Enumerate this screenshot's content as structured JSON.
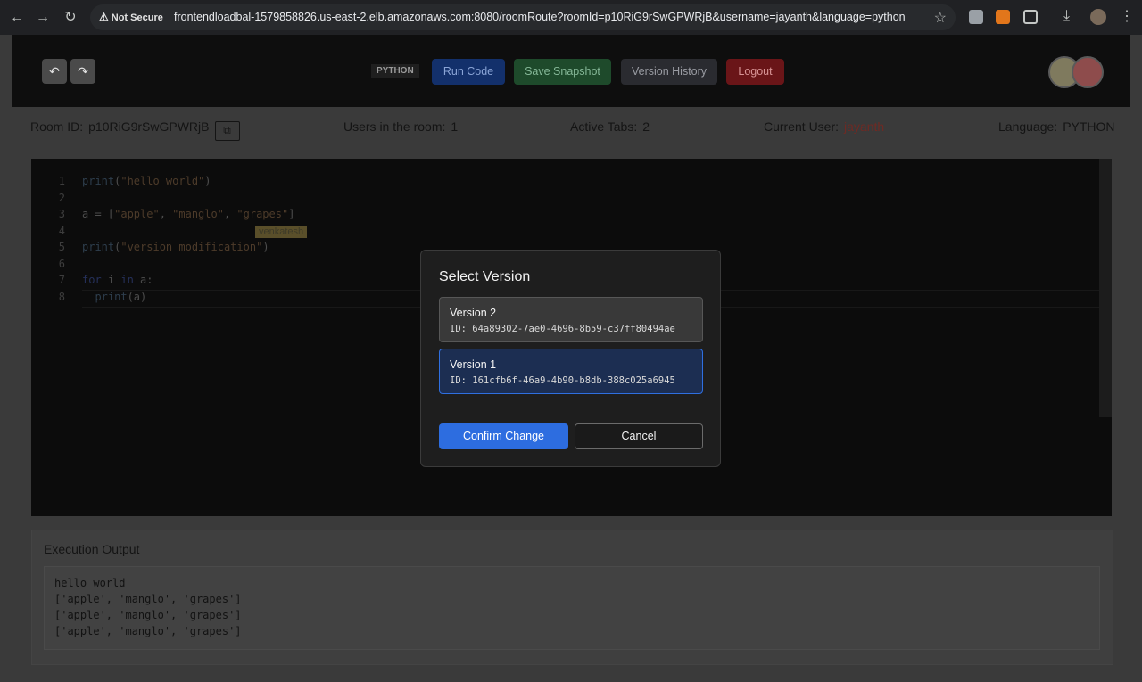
{
  "browser": {
    "security_label": "Not Secure",
    "url": "frontendloadbal-1579858826.us-east-2.elb.amazonaws.com:8080/roomRoute?roomId=p10RiG9rSwGPWRjB&username=jayanth&language=python"
  },
  "toolbar": {
    "undo_icon": "undo-icon",
    "redo_icon": "redo-icon",
    "language_tag": "PYTHON",
    "run_label": "Run Code",
    "snapshot_label": "Save Snapshot",
    "history_label": "Version History",
    "logout_label": "Logout"
  },
  "info": {
    "room_label": "Room ID:",
    "room_id": "p10RiG9rSwGPWRjB",
    "users_label": "Users in the room:",
    "users_count": "1",
    "tabs_label": "Active Tabs:",
    "tabs_count": "2",
    "user_label": "Current User:",
    "user_name": "jayanth",
    "lang_label": "Language:",
    "lang_value": "PYTHON"
  },
  "editor": {
    "line_numbers": [
      "1",
      "2",
      "3",
      "4",
      "5",
      "6",
      "7",
      "8"
    ],
    "cursor_user": "venkatesh"
  },
  "output": {
    "title": "Execution Output",
    "lines": [
      "hello world",
      "['apple', 'manglo', 'grapes']",
      "['apple', 'manglo', 'grapes']",
      "['apple', 'manglo', 'grapes']"
    ]
  },
  "modal": {
    "title": "Select Version",
    "versions": [
      {
        "name": "Version 2",
        "id": "ID: 64a89302-7ae0-4696-8b59-c37ff80494ae",
        "selected": false
      },
      {
        "name": "Version 1",
        "id": "ID: 161cfb6f-46a9-4b90-b8db-388c025a6945",
        "selected": true
      }
    ],
    "confirm_label": "Confirm Change",
    "cancel_label": "Cancel"
  },
  "colors": {
    "accent": "#2d6de0",
    "selected_bg": "#1c2e52"
  }
}
